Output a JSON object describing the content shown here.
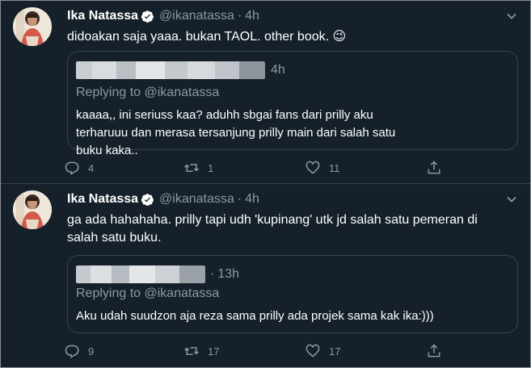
{
  "colors": {
    "background": "#15202b",
    "border": "#38444d",
    "secondary_text": "#8899a6",
    "verified_blue": "#ffffff"
  },
  "tweets": [
    {
      "author_name": "Ika Natassa",
      "handle": "@ikanatassa",
      "separator": "·",
      "time": "4h",
      "text": "didoakan saja yaaa. bukan TAOL. other book. 😉",
      "quote": {
        "time": "4h",
        "replying_label": "Replying to",
        "replying_handle": "@ikanatassa",
        "text": "kaaaa,, ini seriuss kaa? aduhh sbgai fans dari prilly aku terharuuu dan merasa tersanjung prilly main dari salah satu buku kaka.."
      },
      "actions": {
        "reply_count": "4",
        "retweet_count": "1",
        "like_count": "11"
      }
    },
    {
      "author_name": "Ika Natassa",
      "handle": "@ikanatassa",
      "separator": "·",
      "time": "4h",
      "text": "ga ada hahahaha. prilly tapi udh 'kupinang' utk jd salah satu pemeran di salah satu buku.",
      "quote": {
        "separator": "·",
        "time": "13h",
        "replying_label": "Replying to",
        "replying_handle": "@ikanatassa",
        "text": "Aku udah suudzon aja reza sama prilly ada projek sama kak ika:)))"
      },
      "actions": {
        "reply_count": "9",
        "retweet_count": "17",
        "like_count": "17"
      }
    }
  ]
}
